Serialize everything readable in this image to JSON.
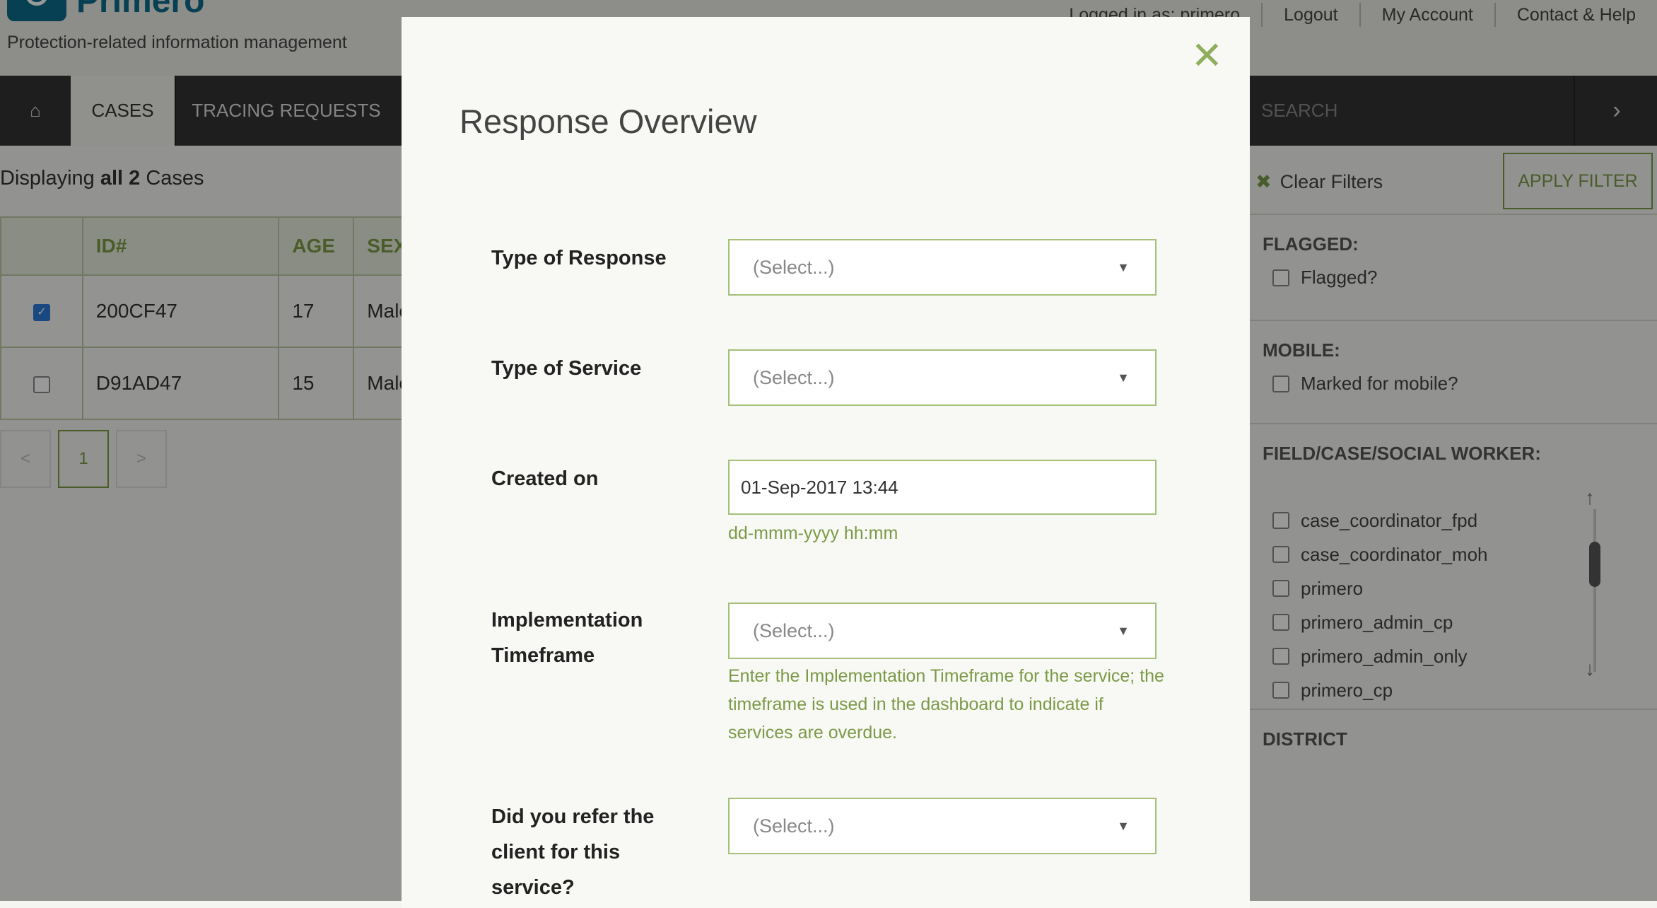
{
  "header": {
    "app_name": "Primero",
    "tagline": "Protection-related information management",
    "links": [
      "Logged in as: primero",
      "Logout",
      "My Account",
      "Contact & Help"
    ]
  },
  "nav": {
    "home_icon": "home-icon",
    "items": [
      "CASES",
      "TRACING REQUESTS"
    ],
    "search_label": "SEARCH",
    "next_icon": "chevron-right-icon"
  },
  "cases": {
    "displaying_prefix": "Displaying",
    "displaying_count": "all 2",
    "displaying_suffix": "Cases",
    "columns": [
      "ID#",
      "AGE",
      "SEX"
    ],
    "rows": [
      {
        "checked": true,
        "id": "200CF47",
        "age": "17",
        "sex": "Male"
      },
      {
        "checked": false,
        "id": "D91AD47",
        "age": "15",
        "sex": "Male"
      }
    ],
    "pagination": {
      "prev": "<",
      "current": "1",
      "next": ">"
    }
  },
  "filters": {
    "clear_label": "Clear Filters",
    "apply_label": "APPLY FILTER",
    "flagged_title": "FLAGGED:",
    "flagged_option": "Flagged?",
    "mobile_title": "MOBILE:",
    "mobile_option": "Marked for mobile?",
    "worker_title": "FIELD/CASE/SOCIAL WORKER:",
    "workers": [
      "case_coordinator_fpd",
      "case_coordinator_moh",
      "primero",
      "primero_admin_cp",
      "primero_admin_only",
      "primero_cp"
    ],
    "district_title": "DISTRICT"
  },
  "modal": {
    "title": "Response Overview",
    "close_icon": "close-icon",
    "fields": {
      "response_type": {
        "label": "Type of Response",
        "placeholder": "(Select...)"
      },
      "service_type": {
        "label": "Type of Service",
        "placeholder": "(Select...)"
      },
      "created_on": {
        "label": "Created on",
        "value": "01-Sep-2017 13:44",
        "help": "dd-mmm-yyyy hh:mm"
      },
      "timeframe": {
        "label": "Implementation Timeframe",
        "placeholder": "(Select...)",
        "help": "Enter the Implementation Timeframe for the service; the timeframe is used in the dashboard to indicate if services are overdue."
      },
      "referral": {
        "label": "Did you refer the client for this service?",
        "placeholder": "(Select...)"
      }
    }
  }
}
